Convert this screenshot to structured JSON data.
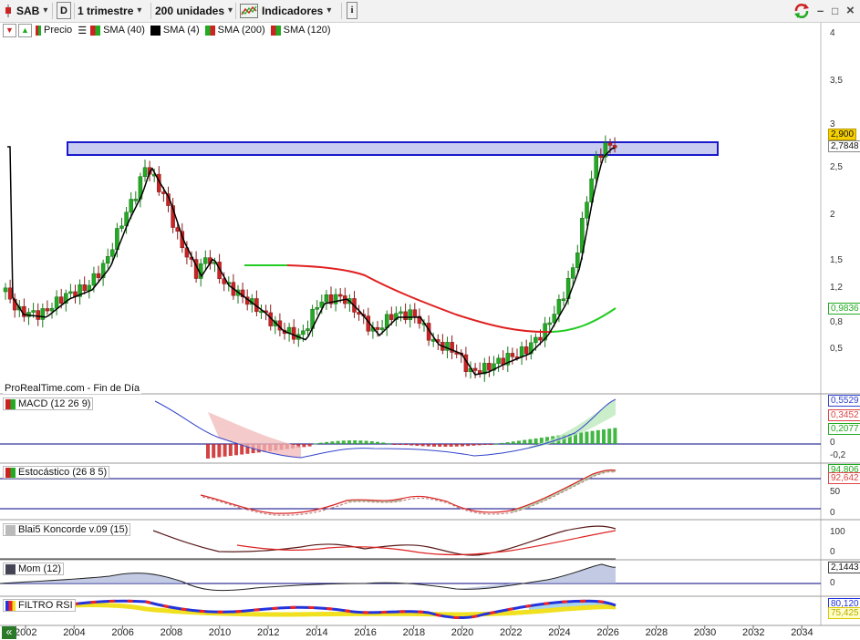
{
  "toolbar": {
    "ticker": "SAB",
    "period_letter": "D",
    "timeframe": "1 trimestre",
    "units": "200 unidades",
    "indicators_label": "Indicadores",
    "info_glyph": "i",
    "minimize_glyph": "–",
    "restore_glyph": "□",
    "close_glyph": "×"
  },
  "legend": {
    "price_label": "Precio",
    "items": [
      {
        "label": "SMA (40)",
        "color": "#e02020"
      },
      {
        "label": "SMA (4)",
        "color": "#000000"
      },
      {
        "label": "SMA (200)",
        "color": "#00c000"
      },
      {
        "label": "SMA (120)",
        "color": "#e02020"
      }
    ]
  },
  "source_label": "ProRealTime.com - Fin de Día",
  "price_axis": {
    "ticks": [
      "4",
      "3,5",
      "3",
      "2,5",
      "2",
      "1,5",
      "1,2",
      "0,8",
      "0,5"
    ],
    "last_price": "2,900",
    "resistance_level": "2,7848",
    "sma200_value": "0,9836"
  },
  "panels": {
    "macd": {
      "label": "MACD (12 26 9)",
      "values": [
        "0,5529",
        "0,3452",
        "0,2077"
      ],
      "ticks": [
        "0",
        "-0,2"
      ]
    },
    "stochastic": {
      "label": "Estocástico (26 8 5)",
      "values": [
        "94,806",
        "92,642"
      ],
      "ticks": [
        "50",
        "0"
      ]
    },
    "koncorde": {
      "label": "Blai5 Koncorde v.09 (15)",
      "ticks": [
        "100",
        "0"
      ]
    },
    "momentum": {
      "label": "Mom (12)",
      "values": [
        "2,1443"
      ],
      "ticks": [
        "0"
      ]
    },
    "rsi_filter": {
      "label": "FILTRO RSI",
      "values": [
        "80,120",
        "75,425"
      ]
    }
  },
  "x_axis": {
    "years": [
      "2002",
      "2004",
      "2006",
      "2008",
      "2010",
      "2012",
      "2014",
      "2016",
      "2018",
      "2020",
      "2022",
      "2024",
      "2026",
      "2028",
      "2030",
      "2032",
      "2034"
    ],
    "nav_glyph": "«"
  },
  "colors": {
    "up": "#22aa22",
    "down": "#cc2222",
    "zone_fill": "#c8ccf0",
    "zone_stroke": "#1a1acc",
    "sma40": "#e02020",
    "sma200": "#22cc22",
    "sma4": "#000000"
  }
}
